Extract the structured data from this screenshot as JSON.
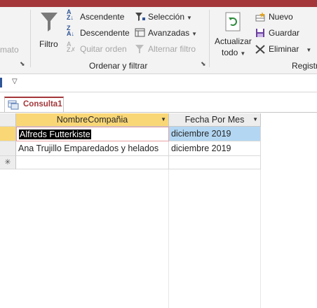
{
  "ribbon": {
    "partial_left_label": "mato",
    "filtro_label": "Filtro",
    "ascendente_label": "Ascendente",
    "descendente_label": "Descendente",
    "quitar_orden_label": "Quitar orden",
    "seleccion_label": "Selección",
    "avanzadas_label": "Avanzadas",
    "alternar_filtro_label": "Alternar filtro",
    "group_ordenar_label": "Ordenar y filtrar",
    "actualizar_line1": "Actualizar",
    "actualizar_line2": "todo",
    "nuevo_label": "Nuevo",
    "guardar_label": "Guardar",
    "eliminar_label": "Eliminar",
    "group_registros_partial": "Registr"
  },
  "document_tab": {
    "label": "Consulta1"
  },
  "grid": {
    "columns": [
      "NombreCompañia",
      "Fecha Por Mes"
    ],
    "rows": [
      [
        "Alfreds Futterkiste",
        "diciembre 2019"
      ],
      [
        "Ana Trujillo Emparedados y helados",
        "diciembre 2019"
      ]
    ],
    "new_record_marker": "✳"
  },
  "colors": {
    "accent": "#a4373a",
    "selected_header": "#fad776",
    "selected_cell": "#b3d7f3",
    "selected_text_bg": "#000000"
  }
}
